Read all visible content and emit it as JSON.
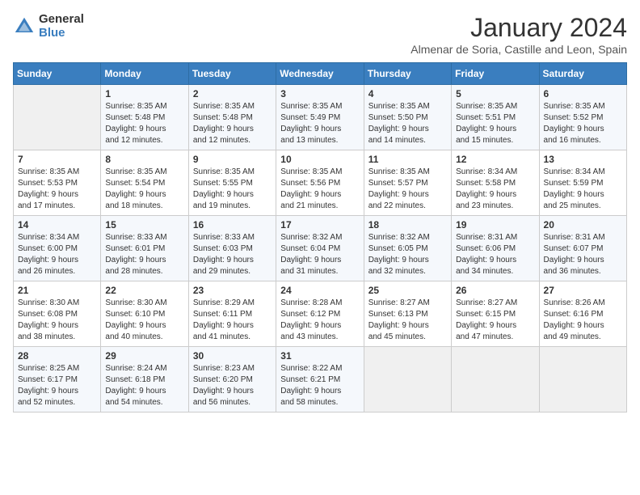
{
  "header": {
    "logo_general": "General",
    "logo_blue": "Blue",
    "month_title": "January 2024",
    "subtitle": "Almenar de Soria, Castille and Leon, Spain"
  },
  "weekdays": [
    "Sunday",
    "Monday",
    "Tuesday",
    "Wednesday",
    "Thursday",
    "Friday",
    "Saturday"
  ],
  "weeks": [
    [
      {
        "day": "",
        "info": ""
      },
      {
        "day": "1",
        "info": "Sunrise: 8:35 AM\nSunset: 5:48 PM\nDaylight: 9 hours\nand 12 minutes."
      },
      {
        "day": "2",
        "info": "Sunrise: 8:35 AM\nSunset: 5:48 PM\nDaylight: 9 hours\nand 12 minutes."
      },
      {
        "day": "3",
        "info": "Sunrise: 8:35 AM\nSunset: 5:49 PM\nDaylight: 9 hours\nand 13 minutes."
      },
      {
        "day": "4",
        "info": "Sunrise: 8:35 AM\nSunset: 5:50 PM\nDaylight: 9 hours\nand 14 minutes."
      },
      {
        "day": "5",
        "info": "Sunrise: 8:35 AM\nSunset: 5:51 PM\nDaylight: 9 hours\nand 15 minutes."
      },
      {
        "day": "6",
        "info": "Sunrise: 8:35 AM\nSunset: 5:52 PM\nDaylight: 9 hours\nand 16 minutes."
      }
    ],
    [
      {
        "day": "7",
        "info": "Sunrise: 8:35 AM\nSunset: 5:53 PM\nDaylight: 9 hours\nand 17 minutes."
      },
      {
        "day": "8",
        "info": "Sunrise: 8:35 AM\nSunset: 5:54 PM\nDaylight: 9 hours\nand 18 minutes."
      },
      {
        "day": "9",
        "info": "Sunrise: 8:35 AM\nSunset: 5:55 PM\nDaylight: 9 hours\nand 19 minutes."
      },
      {
        "day": "10",
        "info": "Sunrise: 8:35 AM\nSunset: 5:56 PM\nDaylight: 9 hours\nand 21 minutes."
      },
      {
        "day": "11",
        "info": "Sunrise: 8:35 AM\nSunset: 5:57 PM\nDaylight: 9 hours\nand 22 minutes."
      },
      {
        "day": "12",
        "info": "Sunrise: 8:34 AM\nSunset: 5:58 PM\nDaylight: 9 hours\nand 23 minutes."
      },
      {
        "day": "13",
        "info": "Sunrise: 8:34 AM\nSunset: 5:59 PM\nDaylight: 9 hours\nand 25 minutes."
      }
    ],
    [
      {
        "day": "14",
        "info": "Sunrise: 8:34 AM\nSunset: 6:00 PM\nDaylight: 9 hours\nand 26 minutes."
      },
      {
        "day": "15",
        "info": "Sunrise: 8:33 AM\nSunset: 6:01 PM\nDaylight: 9 hours\nand 28 minutes."
      },
      {
        "day": "16",
        "info": "Sunrise: 8:33 AM\nSunset: 6:03 PM\nDaylight: 9 hours\nand 29 minutes."
      },
      {
        "day": "17",
        "info": "Sunrise: 8:32 AM\nSunset: 6:04 PM\nDaylight: 9 hours\nand 31 minutes."
      },
      {
        "day": "18",
        "info": "Sunrise: 8:32 AM\nSunset: 6:05 PM\nDaylight: 9 hours\nand 32 minutes."
      },
      {
        "day": "19",
        "info": "Sunrise: 8:31 AM\nSunset: 6:06 PM\nDaylight: 9 hours\nand 34 minutes."
      },
      {
        "day": "20",
        "info": "Sunrise: 8:31 AM\nSunset: 6:07 PM\nDaylight: 9 hours\nand 36 minutes."
      }
    ],
    [
      {
        "day": "21",
        "info": "Sunrise: 8:30 AM\nSunset: 6:08 PM\nDaylight: 9 hours\nand 38 minutes."
      },
      {
        "day": "22",
        "info": "Sunrise: 8:30 AM\nSunset: 6:10 PM\nDaylight: 9 hours\nand 40 minutes."
      },
      {
        "day": "23",
        "info": "Sunrise: 8:29 AM\nSunset: 6:11 PM\nDaylight: 9 hours\nand 41 minutes."
      },
      {
        "day": "24",
        "info": "Sunrise: 8:28 AM\nSunset: 6:12 PM\nDaylight: 9 hours\nand 43 minutes."
      },
      {
        "day": "25",
        "info": "Sunrise: 8:27 AM\nSunset: 6:13 PM\nDaylight: 9 hours\nand 45 minutes."
      },
      {
        "day": "26",
        "info": "Sunrise: 8:27 AM\nSunset: 6:15 PM\nDaylight: 9 hours\nand 47 minutes."
      },
      {
        "day": "27",
        "info": "Sunrise: 8:26 AM\nSunset: 6:16 PM\nDaylight: 9 hours\nand 49 minutes."
      }
    ],
    [
      {
        "day": "28",
        "info": "Sunrise: 8:25 AM\nSunset: 6:17 PM\nDaylight: 9 hours\nand 52 minutes."
      },
      {
        "day": "29",
        "info": "Sunrise: 8:24 AM\nSunset: 6:18 PM\nDaylight: 9 hours\nand 54 minutes."
      },
      {
        "day": "30",
        "info": "Sunrise: 8:23 AM\nSunset: 6:20 PM\nDaylight: 9 hours\nand 56 minutes."
      },
      {
        "day": "31",
        "info": "Sunrise: 8:22 AM\nSunset: 6:21 PM\nDaylight: 9 hours\nand 58 minutes."
      },
      {
        "day": "",
        "info": ""
      },
      {
        "day": "",
        "info": ""
      },
      {
        "day": "",
        "info": ""
      }
    ]
  ]
}
